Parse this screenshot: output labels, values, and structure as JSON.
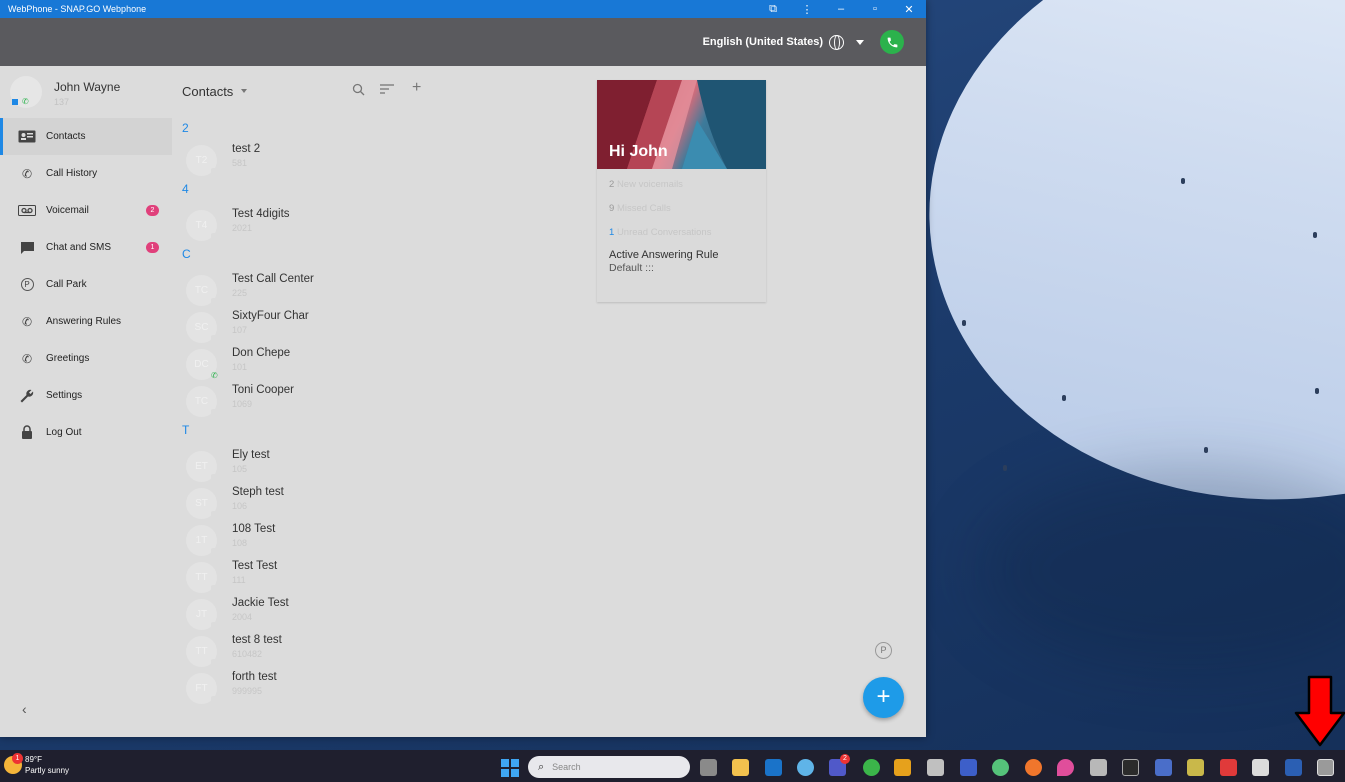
{
  "window": {
    "title": "WebPhone - SNAP.GO Webphone",
    "buttons": [
      "puzzle",
      "more",
      "minimize",
      "maximize",
      "close"
    ]
  },
  "appbar": {
    "language": "English (United States)"
  },
  "user": {
    "name": "John Wayne",
    "extension": "137"
  },
  "nav": [
    {
      "label": "Contacts",
      "icon": "contacts-icon",
      "active": true
    },
    {
      "label": "Call History",
      "icon": "call-history-icon"
    },
    {
      "label": "Voicemail",
      "icon": "voicemail-icon",
      "badge": "2"
    },
    {
      "label": "Chat and SMS",
      "icon": "chat-icon",
      "badge": "1"
    },
    {
      "label": "Call Park",
      "icon": "call-park-icon"
    },
    {
      "label": "Answering Rules",
      "icon": "answering-rules-icon"
    },
    {
      "label": "Greetings",
      "icon": "greetings-icon"
    },
    {
      "label": "Settings",
      "icon": "wrench-icon"
    },
    {
      "label": "Log Out",
      "icon": "lock-icon"
    }
  ],
  "contacts": {
    "title": "Contacts",
    "groups": [
      {
        "letter": "2",
        "items": [
          {
            "name": "test 2",
            "ext": "581",
            "initials": "T2"
          }
        ]
      },
      {
        "letter": "4",
        "items": [
          {
            "name": "Test 4digits",
            "ext": "2021",
            "initials": "T4"
          }
        ]
      },
      {
        "letter": "C",
        "items": [
          {
            "name": "Test Call Center",
            "ext": "225",
            "initials": "TC"
          },
          {
            "name": "SixtyFour Char",
            "ext": "107",
            "initials": "SC"
          },
          {
            "name": "Don Chepe",
            "ext": "101",
            "initials": "DC",
            "online": true
          },
          {
            "name": "Toni Cooper",
            "ext": "1069",
            "initials": "TC"
          }
        ]
      },
      {
        "letter": "T",
        "items": [
          {
            "name": "Ely test",
            "ext": "105",
            "initials": "ET"
          },
          {
            "name": "Steph test",
            "ext": "106",
            "initials": "ST"
          },
          {
            "name": "108 Test",
            "ext": "108",
            "initials": "1T"
          },
          {
            "name": "Test Test",
            "ext": "111",
            "initials": "TT"
          },
          {
            "name": "Jackie Test",
            "ext": "2004",
            "initials": "JT"
          },
          {
            "name": "test 8 test",
            "ext": "610482",
            "initials": "TT"
          },
          {
            "name": "forth test",
            "ext": "999995",
            "initials": "FT"
          }
        ]
      }
    ]
  },
  "card": {
    "greeting": "Hi John",
    "voicemails": {
      "count": "2",
      "text": "New voicemails"
    },
    "missed": {
      "count": "9",
      "text": "Missed Calls"
    },
    "unread": {
      "count": "1",
      "text": "Unread Conversations"
    },
    "rule_title": "Active Answering Rule",
    "rule_value": "Default :::"
  },
  "fab": {
    "add": "+",
    "park": "P"
  },
  "taskbar": {
    "weather_temp": "89°F",
    "weather_desc": "Partly sunny",
    "weather_badge": "1",
    "search_placeholder": "Search",
    "teams_badge": "2"
  },
  "colors": {
    "accent": "#1e88e5",
    "badge": "#e0407b",
    "status_green": "#2bb24c",
    "titlebar": "#1878d6",
    "fab": "#1e9be8",
    "arrow": "#ff0000"
  }
}
